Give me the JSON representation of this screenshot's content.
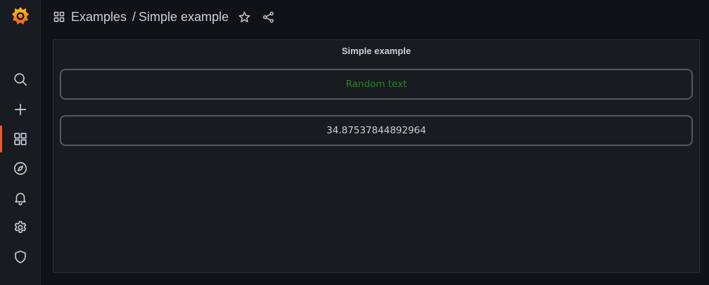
{
  "breadcrumb": {
    "parent": "Examples",
    "separator": "/",
    "current": "Simple example"
  },
  "sidebar": {
    "items": [
      {
        "icon": "search-icon"
      },
      {
        "icon": "plus-icon"
      },
      {
        "icon": "dashboards-icon",
        "active": true
      },
      {
        "icon": "compass-icon"
      },
      {
        "icon": "bell-icon"
      },
      {
        "icon": "gear-icon"
      },
      {
        "icon": "shield-icon"
      }
    ]
  },
  "panel": {
    "title": "Simple example",
    "text_value": "Random text",
    "number_value": "34.87537844892964"
  },
  "colors": {
    "accent": "#f05a28",
    "text_green": "#1f8a1f"
  }
}
